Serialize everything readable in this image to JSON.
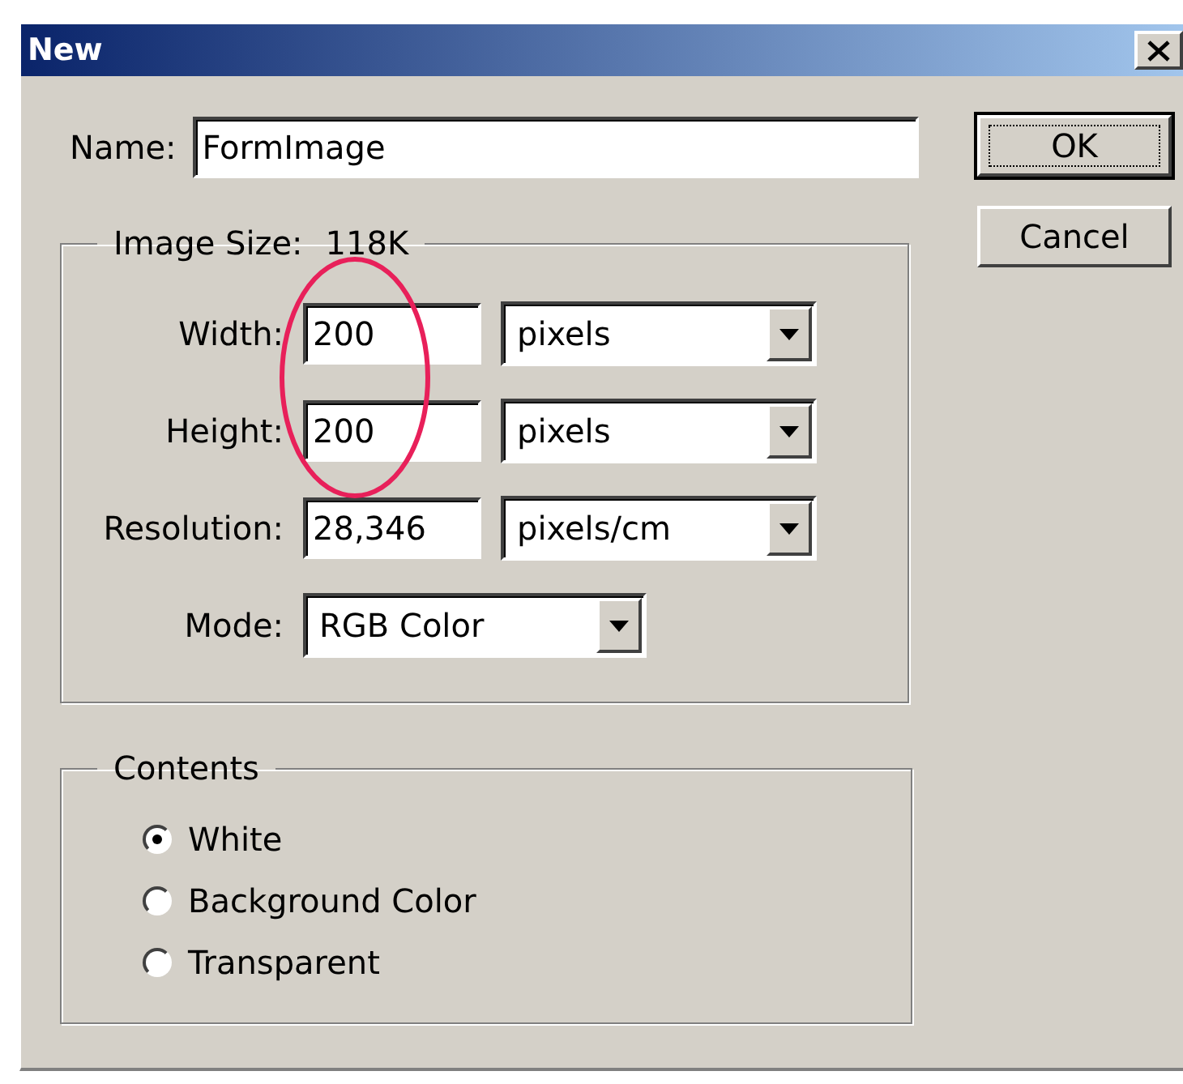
{
  "window": {
    "title": "New"
  },
  "name": {
    "label": "Name:",
    "value": "FormImage"
  },
  "image_size": {
    "legend": "Image Size:",
    "size": "118K",
    "fields": [
      {
        "label": "Width:",
        "value": "200",
        "unit": "pixels"
      },
      {
        "label": "Height:",
        "value": "200",
        "unit": "pixels"
      },
      {
        "label": "Resolution:",
        "value": "28,346",
        "unit": "pixels/cm"
      }
    ],
    "mode": {
      "label": "Mode:",
      "value": "RGB Color"
    }
  },
  "contents": {
    "legend": "Contents",
    "options": [
      {
        "label": "White",
        "selected": true
      },
      {
        "label": "Background Color",
        "selected": false
      },
      {
        "label": "Transparent",
        "selected": false
      }
    ]
  },
  "buttons": [
    {
      "label": "OK",
      "default": true
    },
    {
      "label": "Cancel",
      "default": false
    }
  ]
}
